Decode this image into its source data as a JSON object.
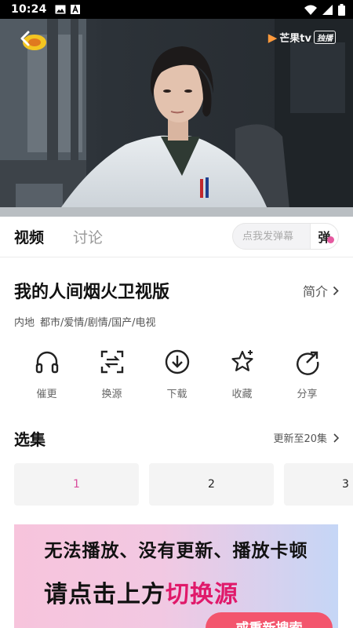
{
  "status_bar": {
    "time": "10:24",
    "left_icons": [
      "image-icon",
      "a-notification-icon"
    ],
    "right_icons": [
      "wifi-icon",
      "signal-icon",
      "battery-icon"
    ]
  },
  "player": {
    "watermark_brand": "芒果tv",
    "watermark_badge": "独播",
    "back_icon": "back-arrow-icon"
  },
  "tabs": [
    "视频",
    "讨论"
  ],
  "danmu": {
    "placeholder": "点我发弹幕",
    "button_label": "弹"
  },
  "show": {
    "title": "我的人间烟火卫视版",
    "intro_label": "简介",
    "tags": [
      "内地",
      "都市/爱情/剧情/国产/电视"
    ]
  },
  "actions": [
    {
      "label": "催更",
      "icon": "headphones-icon"
    },
    {
      "label": "换源",
      "icon": "switch-source-icon"
    },
    {
      "label": "下载",
      "icon": "download-icon"
    },
    {
      "label": "收藏",
      "icon": "star-icon"
    },
    {
      "label": "分享",
      "icon": "share-icon"
    }
  ],
  "episodes": {
    "title": "选集",
    "update_label": "更新至20集",
    "items": [
      "1",
      "2",
      "3"
    ],
    "current": "1"
  },
  "banner": {
    "line1": "无法播放、没有更新、播放卡顿",
    "line2_prefix": "请点击上方",
    "line2_highlight": "切换源",
    "button_label": "或重新搜索"
  },
  "colors": {
    "accent_pink": "#d94c9c",
    "banner_button": "#f3556d",
    "banner_highlight": "#e0196a"
  }
}
